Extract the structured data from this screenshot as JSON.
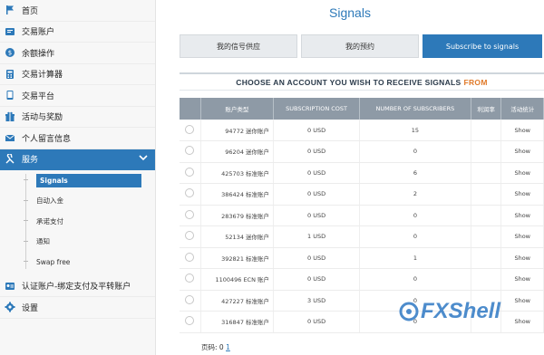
{
  "sidebar": {
    "items": [
      {
        "label": "首页",
        "icon": "flag-icon"
      },
      {
        "label": "交易账户",
        "icon": "accounts-icon"
      },
      {
        "label": "余额操作",
        "icon": "balance-icon"
      },
      {
        "label": "交易计算器",
        "icon": "calculator-icon"
      },
      {
        "label": "交易平台",
        "icon": "platform-icon"
      },
      {
        "label": "活动与奖励",
        "icon": "gift-icon"
      },
      {
        "label": "个人留言信息",
        "icon": "mail-icon"
      },
      {
        "label": "服务",
        "icon": "services-icon",
        "active": true
      }
    ],
    "subitems": [
      {
        "label": "Signals",
        "active": true
      },
      {
        "label": "自动入金"
      },
      {
        "label": "承诺支付"
      },
      {
        "label": "通知"
      },
      {
        "label": "Swap free"
      }
    ],
    "bottom_items": [
      {
        "label": "认证账户-绑定支付及平转账户",
        "icon": "verify-icon"
      },
      {
        "label": "设置",
        "icon": "gear-icon"
      }
    ]
  },
  "page": {
    "title": "Signals",
    "tabs": [
      {
        "label": "我的信号供应"
      },
      {
        "label": "我的预约"
      },
      {
        "label": "Subscribe to signals",
        "active": true
      }
    ],
    "heading": "CHOOSE AN ACCOUNT YOU WISH TO RECEIVE SIGNALS",
    "heading_accent": "FROM"
  },
  "table": {
    "columns": [
      "账户类型",
      "SUBSCRIPTION COST",
      "NUMBER OF SUBSCRIBERS",
      "利润率",
      "活动统计"
    ],
    "rows": [
      {
        "account": "94772 迷你账户",
        "cost": "0 USD",
        "subscribers": "15",
        "profit": "",
        "stats": "Show"
      },
      {
        "account": "96204 迷你账户",
        "cost": "0 USD",
        "subscribers": "0",
        "profit": "",
        "stats": "Show"
      },
      {
        "account": "425703 标准账户",
        "cost": "0 USD",
        "subscribers": "6",
        "profit": "",
        "stats": "Show"
      },
      {
        "account": "386424 标准账户",
        "cost": "0 USD",
        "subscribers": "2",
        "profit": "",
        "stats": "Show"
      },
      {
        "account": "283679 标准账户",
        "cost": "0 USD",
        "subscribers": "0",
        "profit": "",
        "stats": "Show"
      },
      {
        "account": "52134 迷你账户",
        "cost": "1 USD",
        "subscribers": "0",
        "profit": "",
        "stats": "Show"
      },
      {
        "account": "392821 标准账户",
        "cost": "0 USD",
        "subscribers": "1",
        "profit": "",
        "stats": "Show"
      },
      {
        "account": "1100496 ECN 账户",
        "cost": "0 USD",
        "subscribers": "0",
        "profit": "",
        "stats": "Show"
      },
      {
        "account": "427227 标准账户",
        "cost": "3 USD",
        "subscribers": "0",
        "profit": "",
        "stats": "Show"
      },
      {
        "account": "316847 标准账户",
        "cost": "0 USD",
        "subscribers": "0",
        "profit": "",
        "stats": "Show"
      }
    ]
  },
  "pager": {
    "label": "页码: 0",
    "link": "1"
  },
  "watermark": {
    "text": "FXShell"
  },
  "colors": {
    "accent": "#2d79b9",
    "heading_accent": "#e07a2a",
    "table_header": "#8e9aa6"
  }
}
